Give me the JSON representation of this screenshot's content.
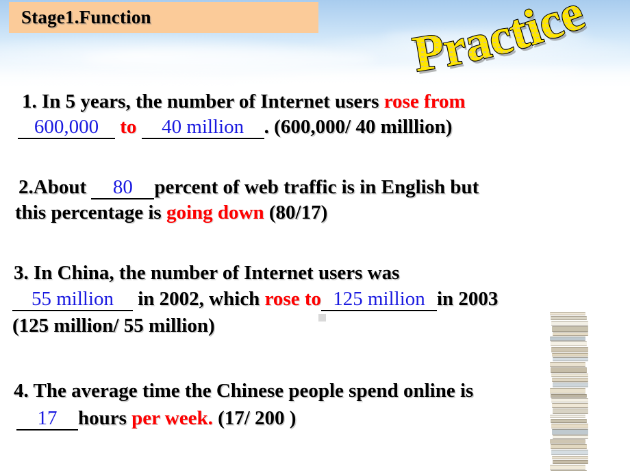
{
  "slide": {
    "stage_title": "Stage1.Function",
    "wordart_title": "Practice",
    "colors": {
      "stage_box_fill": "#fbcb99",
      "answer_blue": "#1a1ae0",
      "highlight_red": "#fe0000",
      "wordart_fill": "#ffe600",
      "wordart_outline": "#000000",
      "sky_top": "#a8ccee"
    },
    "decorations": {
      "books_image": "stack-of-books"
    }
  },
  "questions": [
    {
      "number": "1.",
      "line1": {
        "pre": "1. In 5 years, the number of Internet users ",
        "red": "rose from"
      },
      "line2": {
        "blank1": "600,000",
        "mid_red": "to",
        "blank2": "40 million",
        "post": ". (600,000/ 40 milllion)"
      }
    },
    {
      "number": "2.",
      "line1": {
        "pre": "2.About ",
        "blank": "80",
        "post": "percent of web traffic is in English but"
      },
      "line2": {
        "pre": "this percentage is ",
        "red": "going down",
        "post": " (80/17)"
      }
    },
    {
      "number": "3.",
      "line1": "3. In China, the number of Internet users was",
      "line2": {
        "blank1": "55 million",
        "mid": "in 2002, which ",
        "red": "rose to",
        "blank2": "125 million",
        "post": "in 2003"
      },
      "line3": "(125 million/ 55 million)"
    },
    {
      "number": "4.",
      "line1": "4. The average time the Chinese people spend online is",
      "line2": {
        "blank": "17",
        "mid": "hours ",
        "red": "per week.",
        "post": " (17/ 200 )"
      }
    }
  ]
}
